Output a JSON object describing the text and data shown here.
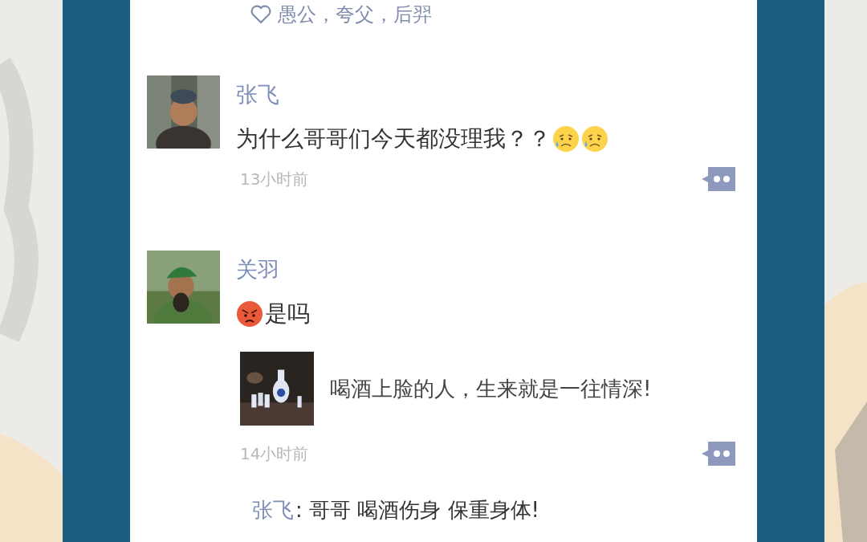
{
  "likes": {
    "names": "愚公，夸父，后羿"
  },
  "posts": [
    {
      "author": "张飞",
      "text": "为什么哥哥们今天都没理我？？",
      "emoji_after": [
        {
          "kind": "sad"
        },
        {
          "kind": "sad"
        }
      ],
      "time": "13小时前"
    },
    {
      "author": "关羽",
      "emoji_before": [
        {
          "kind": "angry"
        }
      ],
      "text": "是吗",
      "link": {
        "kind": "picture",
        "title": "喝酒上脸的人，生来就是一往情深!"
      },
      "time": "14小时前",
      "comments": [
        {
          "author": "张飞",
          "text": ": 哥哥 喝酒伤身 保重身体!"
        }
      ]
    }
  ]
}
